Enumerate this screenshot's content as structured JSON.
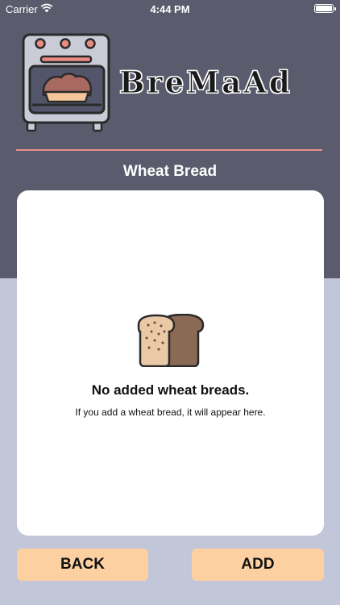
{
  "status_bar": {
    "carrier": "Carrier",
    "time": "4:44 PM"
  },
  "header": {
    "brand": "BreMaAd",
    "logo_icon": "oven-with-bread-icon",
    "title": "Wheat Bread",
    "divider_color": "#e8928e"
  },
  "empty_state": {
    "icon": "bread-loaf-icon",
    "title": "No added wheat breads.",
    "subtitle": "If you add a wheat bread, it will appear here."
  },
  "actions": {
    "back_label": "BACK",
    "add_label": "ADD",
    "button_color": "#fdd0a2"
  },
  "colors": {
    "header_bg": "#5a5c6e",
    "page_bg": "#c1c6d8"
  }
}
